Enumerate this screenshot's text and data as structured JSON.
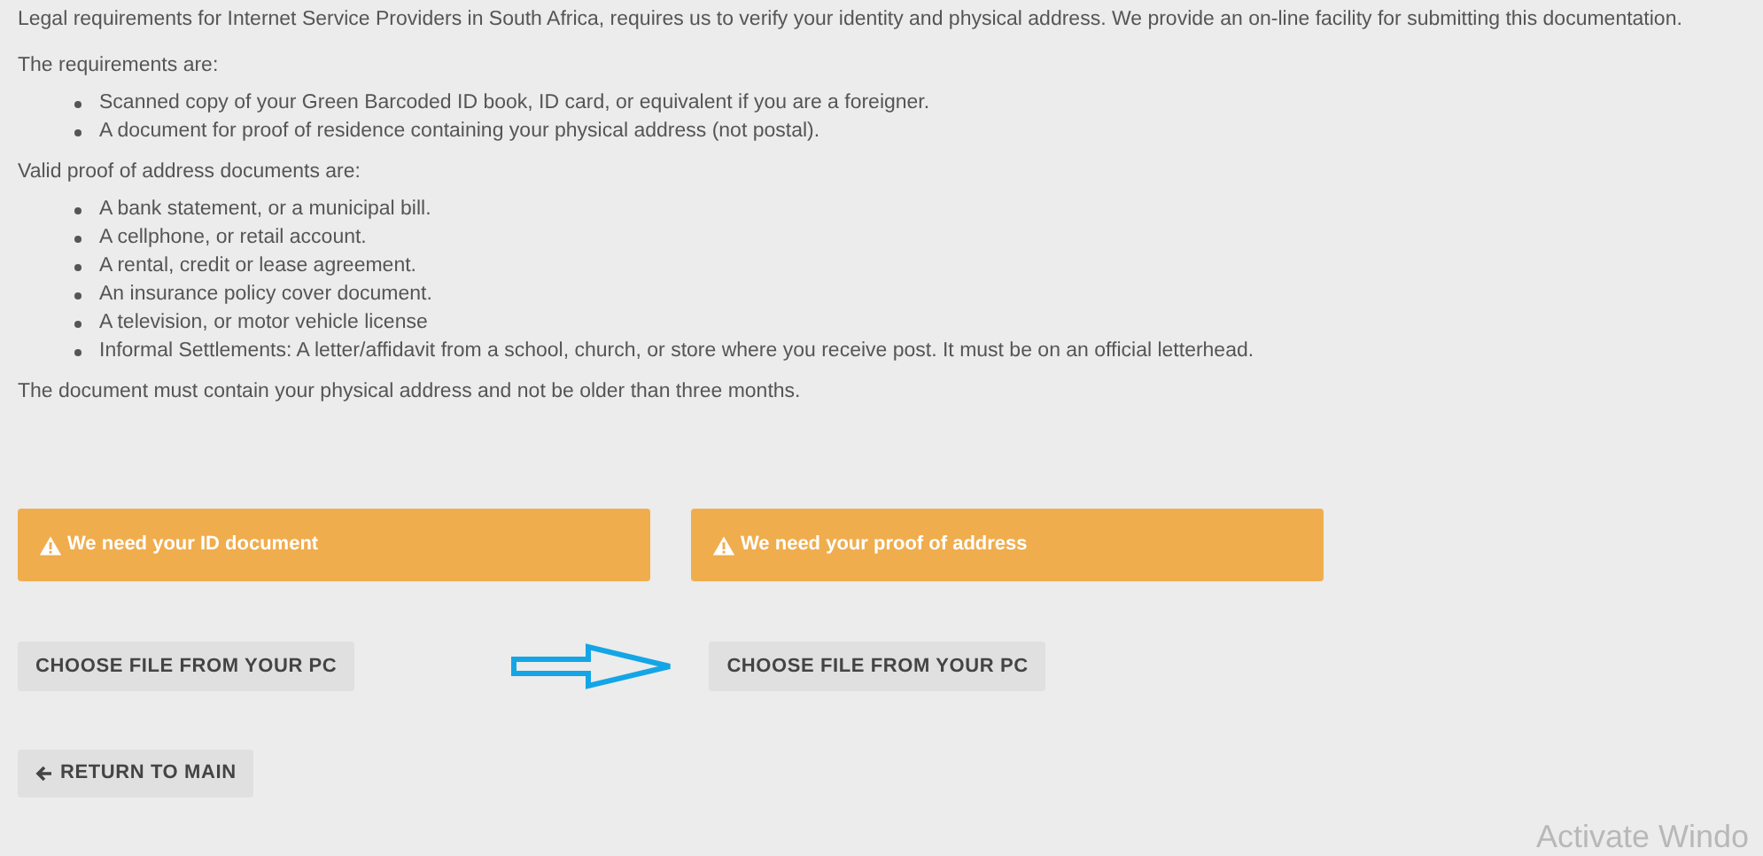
{
  "intro": "Legal requirements for Internet Service Providers in South Africa, requires us to verify your identity and physical address. We provide an on-line facility for submitting this documentation.",
  "requirements_heading": "The requirements are:",
  "requirements": [
    "Scanned copy of your Green Barcoded ID book, ID card, or equivalent if you are a foreigner.",
    "A document for proof of residence containing your physical address (not postal)."
  ],
  "proof_heading": "Valid proof of address documents are:",
  "proof_documents": [
    "A bank statement, or a municipal bill.",
    "A cellphone, or retail account.",
    "A rental, credit or lease agreement.",
    "An insurance policy cover document.",
    "A television, or motor vehicle license",
    "Informal Settlements: A letter/affidavit from a school, church, or store where you receive post. It must be on an official letterhead."
  ],
  "note": "The document must contain your physical address and not be older than three months.",
  "uploads": [
    {
      "alert": "We need your ID document",
      "button": "CHOOSE FILE FROM YOUR PC"
    },
    {
      "alert": "We need your proof of address",
      "button": "CHOOSE FILE FROM YOUR PC"
    }
  ],
  "return_button": "RETURN TO MAIN",
  "os_overlay": "Activate Windo"
}
